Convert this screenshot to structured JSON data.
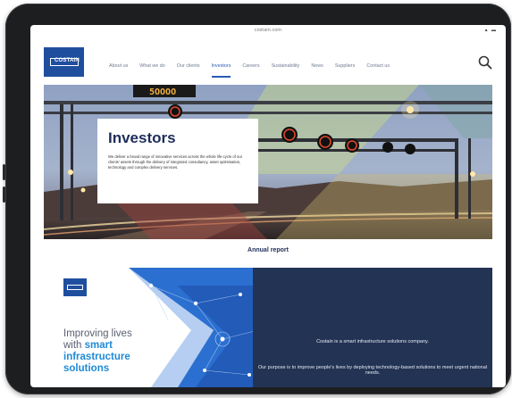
{
  "browser": {
    "url": "costain.com",
    "status_icons": "▲ ▬"
  },
  "header": {
    "logo_text": "COSTAIN",
    "nav": [
      {
        "label": "About us"
      },
      {
        "label": "What we do"
      },
      {
        "label": "Our clients"
      },
      {
        "label": "Investors",
        "active": true
      },
      {
        "label": "Careers"
      },
      {
        "label": "Sustainability"
      },
      {
        "label": "News"
      },
      {
        "label": "Suppliers"
      },
      {
        "label": "Contact us"
      }
    ]
  },
  "hero": {
    "title": "Investors",
    "description": "We deliver a broad range of innovative services across the whole life-cycle of our clients' assets through the delivery of integrated consultancy, asset optimisation, technology and complex delivery services.",
    "gantry_sign_text": "50"
  },
  "annual_report_label": "Annual report",
  "banner": {
    "line_plain_1": "Improving lives",
    "line_plain_2": "with ",
    "line_highlight": "smart infrastructure solutions",
    "right_line_1": "Costain is a smart infrastructure solutions company.",
    "right_line_2": "Our purpose is to improve people's lives by deploying technology-based solutions to meet urgent national needs."
  },
  "colors": {
    "brand_blue": "#1f4e9e",
    "navy_panel": "#233353",
    "highlight_blue": "#1f8ad6",
    "active_nav": "#2a5bb5"
  }
}
